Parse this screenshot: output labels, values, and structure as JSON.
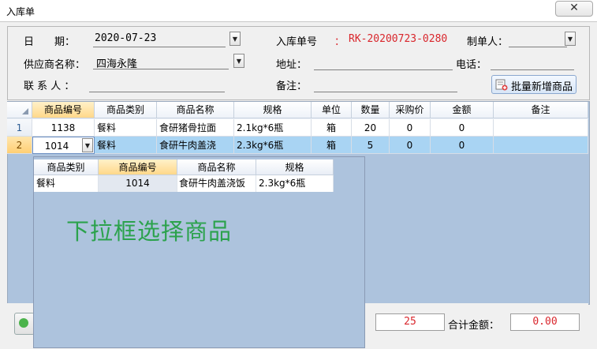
{
  "window": {
    "title": "入库单",
    "close_glyph": "✕"
  },
  "form": {
    "date_label": "日　　期：",
    "date_value": "2020-07-23",
    "order_no_label": "入库单号",
    "order_no_value": "RK-20200723-0280",
    "maker_label": "制单人：",
    "maker_value": "",
    "supplier_label": "供应商名称：",
    "supplier_value": "四海永隆",
    "address_label": "地址：",
    "address_value": "",
    "phone_label": "电话：",
    "phone_value": "",
    "contact_label": "联 系 人 ：",
    "contact_value": "",
    "remark_label": "备注：",
    "remark_value": "",
    "batch_add_label": "批量新增商品"
  },
  "grid": {
    "columns": [
      "商品编号",
      "商品类别",
      "商品名称",
      "规格",
      "单位",
      "数量",
      "采购价",
      "金额",
      "备注"
    ],
    "rows": [
      {
        "num": "1",
        "code": "1138",
        "category": "餐料",
        "name": "食研猪骨拉面",
        "spec": "2.1kg*6瓶",
        "unit": "箱",
        "qty": "20",
        "price": "0",
        "amount": "0",
        "note": ""
      },
      {
        "num": "2",
        "code": "1014",
        "category": "餐料",
        "name": "食研牛肉盖浇",
        "spec": "2.3kg*6瓶",
        "unit": "箱",
        "qty": "5",
        "price": "0",
        "amount": "0",
        "note": ""
      }
    ],
    "selected_row": 1,
    "selected_column": "商品编号"
  },
  "dropdown": {
    "columns": [
      "商品类别",
      "商品编号",
      "商品名称",
      "规格"
    ],
    "rows": [
      {
        "category": "餐料",
        "code": "1014",
        "name": "食研牛肉盖浇饭",
        "spec": "2.3kg*6瓶"
      }
    ],
    "annotation": "下拉框选择商品"
  },
  "footer": {
    "total_qty": "25",
    "total_amount_label": "合计金额：",
    "total_amount_value": "0.00"
  },
  "colors": {
    "order_no": "#d9262c",
    "annotation": "#2ba24c",
    "grid_bg": "#adc3dd",
    "row_selected": "#a9d4f3"
  },
  "icons": [
    "close-icon",
    "dropdown-arrow-icon",
    "batch-add-icon",
    "add-icon",
    "corner-select-icon"
  ]
}
